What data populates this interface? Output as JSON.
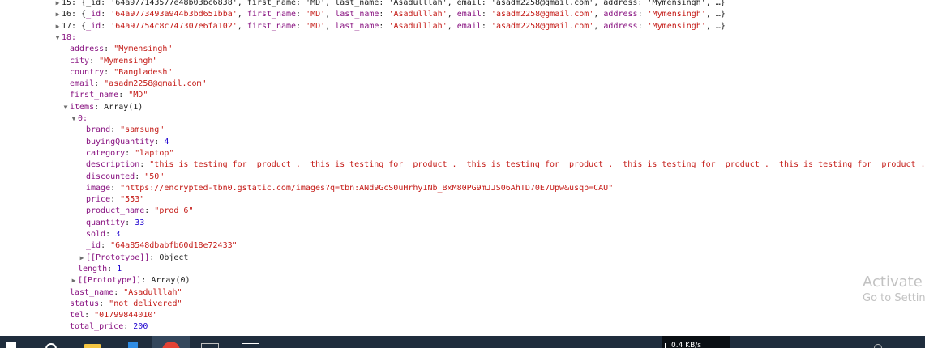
{
  "console": {
    "lines": [
      {
        "indent": 0,
        "toggle": "collapsed",
        "parts": [
          {
            "t": "15: {_id: '64a977143577e48b03bc6838', first_name: 'MD', last_name: 'Asadulllah', email: 'asadm2258@gmail.com', address: 'Mymensingh', …}",
            "c": "p"
          }
        ]
      },
      {
        "indent": 0,
        "toggle": "collapsed",
        "parts": [
          {
            "t": "16: ",
            "c": "p"
          },
          {
            "t": "{",
            "c": "p"
          },
          {
            "t": "_id",
            "c": "sk"
          },
          {
            "t": ": ",
            "c": "p"
          },
          {
            "t": "'64a9773493a944b3bd651bba'",
            "c": "ss"
          },
          {
            "t": ", ",
            "c": "p"
          },
          {
            "t": "first_name",
            "c": "sk"
          },
          {
            "t": ": ",
            "c": "p"
          },
          {
            "t": "'MD'",
            "c": "ss"
          },
          {
            "t": ", ",
            "c": "p"
          },
          {
            "t": "last_name",
            "c": "sk"
          },
          {
            "t": ": ",
            "c": "p"
          },
          {
            "t": "'Asadulllah'",
            "c": "ss"
          },
          {
            "t": ", ",
            "c": "p"
          },
          {
            "t": "email",
            "c": "sk"
          },
          {
            "t": ": ",
            "c": "p"
          },
          {
            "t": "'asadm2258@gmail.com'",
            "c": "ss"
          },
          {
            "t": ", ",
            "c": "p"
          },
          {
            "t": "address",
            "c": "sk"
          },
          {
            "t": ": ",
            "c": "p"
          },
          {
            "t": "'Mymensingh'",
            "c": "ss"
          },
          {
            "t": ", …}",
            "c": "p"
          }
        ]
      },
      {
        "indent": 0,
        "toggle": "collapsed",
        "parts": [
          {
            "t": "17: ",
            "c": "p"
          },
          {
            "t": "{",
            "c": "p"
          },
          {
            "t": "_id",
            "c": "sk"
          },
          {
            "t": ": ",
            "c": "p"
          },
          {
            "t": "'64a97754c8c747307e6fa102'",
            "c": "ss"
          },
          {
            "t": ", ",
            "c": "p"
          },
          {
            "t": "first_name",
            "c": "sk"
          },
          {
            "t": ": ",
            "c": "p"
          },
          {
            "t": "'MD'",
            "c": "ss"
          },
          {
            "t": ", ",
            "c": "p"
          },
          {
            "t": "last_name",
            "c": "sk"
          },
          {
            "t": ": ",
            "c": "p"
          },
          {
            "t": "'Asadulllah'",
            "c": "ss"
          },
          {
            "t": ", ",
            "c": "p"
          },
          {
            "t": "email",
            "c": "sk"
          },
          {
            "t": ": ",
            "c": "p"
          },
          {
            "t": "'asadm2258@gmail.com'",
            "c": "ss"
          },
          {
            "t": ", ",
            "c": "p"
          },
          {
            "t": "address",
            "c": "sk"
          },
          {
            "t": ": ",
            "c": "p"
          },
          {
            "t": "'Mymensingh'",
            "c": "ss"
          },
          {
            "t": ", …}",
            "c": "p"
          }
        ]
      },
      {
        "indent": 0,
        "toggle": "expanded",
        "parts": [
          {
            "t": "18:",
            "c": "k"
          }
        ]
      },
      {
        "indent": 1,
        "toggle": "none",
        "parts": [
          {
            "t": "address",
            "c": "k"
          },
          {
            "t": ": ",
            "c": "p"
          },
          {
            "t": "\"Mymensingh\"",
            "c": "s"
          }
        ]
      },
      {
        "indent": 1,
        "toggle": "none",
        "parts": [
          {
            "t": "city",
            "c": "k"
          },
          {
            "t": ": ",
            "c": "p"
          },
          {
            "t": "\"Mymensingh\"",
            "c": "s"
          }
        ]
      },
      {
        "indent": 1,
        "toggle": "none",
        "parts": [
          {
            "t": "country",
            "c": "k"
          },
          {
            "t": ": ",
            "c": "p"
          },
          {
            "t": "\"Bangladesh\"",
            "c": "s"
          }
        ]
      },
      {
        "indent": 1,
        "toggle": "none",
        "parts": [
          {
            "t": "email",
            "c": "k"
          },
          {
            "t": ": ",
            "c": "p"
          },
          {
            "t": "\"asadm2258@gmail.com\"",
            "c": "s"
          }
        ]
      },
      {
        "indent": 1,
        "toggle": "none",
        "parts": [
          {
            "t": "first_name",
            "c": "k"
          },
          {
            "t": ": ",
            "c": "p"
          },
          {
            "t": "\"MD\"",
            "c": "s"
          }
        ]
      },
      {
        "indent": 1,
        "toggle": "expanded",
        "parts": [
          {
            "t": "items",
            "c": "k"
          },
          {
            "t": ": Array(1)",
            "c": "p"
          }
        ]
      },
      {
        "indent": 2,
        "toggle": "expanded",
        "parts": [
          {
            "t": "0:",
            "c": "k"
          }
        ]
      },
      {
        "indent": 3,
        "toggle": "none",
        "parts": [
          {
            "t": "brand",
            "c": "k"
          },
          {
            "t": ": ",
            "c": "p"
          },
          {
            "t": "\"samsung\"",
            "c": "s"
          }
        ]
      },
      {
        "indent": 3,
        "toggle": "none",
        "parts": [
          {
            "t": "buyingQuantity",
            "c": "k"
          },
          {
            "t": ": ",
            "c": "p"
          },
          {
            "t": "4",
            "c": "n"
          }
        ]
      },
      {
        "indent": 3,
        "toggle": "none",
        "parts": [
          {
            "t": "category",
            "c": "k"
          },
          {
            "t": ": ",
            "c": "p"
          },
          {
            "t": "\"laptop\"",
            "c": "s"
          }
        ]
      },
      {
        "indent": 3,
        "toggle": "none",
        "parts": [
          {
            "t": "description",
            "c": "k"
          },
          {
            "t": ": ",
            "c": "p"
          },
          {
            "t": "\"this is testing for  product .  this is testing for  product .  this is testing for  product .  this is testing for  product .  this is testing for  product . \"",
            "c": "s"
          }
        ]
      },
      {
        "indent": 3,
        "toggle": "none",
        "parts": [
          {
            "t": "discounted",
            "c": "k"
          },
          {
            "t": ": ",
            "c": "p"
          },
          {
            "t": "\"50\"",
            "c": "s"
          }
        ]
      },
      {
        "indent": 3,
        "toggle": "none",
        "parts": [
          {
            "t": "image",
            "c": "k"
          },
          {
            "t": ": ",
            "c": "p"
          },
          {
            "t": "\"https://encrypted-tbn0.gstatic.com/images?q=tbn:ANd9GcS0uHrhy1Nb_BxM80PG9mJJS06AhTD70E7Upw&usqp=CAU\"",
            "c": "s"
          }
        ]
      },
      {
        "indent": 3,
        "toggle": "none",
        "parts": [
          {
            "t": "price",
            "c": "k"
          },
          {
            "t": ": ",
            "c": "p"
          },
          {
            "t": "\"553\"",
            "c": "s"
          }
        ]
      },
      {
        "indent": 3,
        "toggle": "none",
        "parts": [
          {
            "t": "product_name",
            "c": "k"
          },
          {
            "t": ": ",
            "c": "p"
          },
          {
            "t": "\"prod 6\"",
            "c": "s"
          }
        ]
      },
      {
        "indent": 3,
        "toggle": "none",
        "parts": [
          {
            "t": "quantity",
            "c": "k"
          },
          {
            "t": ": ",
            "c": "p"
          },
          {
            "t": "33",
            "c": "n"
          }
        ]
      },
      {
        "indent": 3,
        "toggle": "none",
        "parts": [
          {
            "t": "sold",
            "c": "k"
          },
          {
            "t": ": ",
            "c": "p"
          },
          {
            "t": "3",
            "c": "n"
          }
        ]
      },
      {
        "indent": 3,
        "toggle": "none",
        "parts": [
          {
            "t": "_id",
            "c": "k"
          },
          {
            "t": ": ",
            "c": "p"
          },
          {
            "t": "\"64a8548dbabfb60d18e72433\"",
            "c": "s"
          }
        ]
      },
      {
        "indent": 3,
        "toggle": "collapsed",
        "parts": [
          {
            "t": "[[Prototype]]",
            "c": "k"
          },
          {
            "t": ": Object",
            "c": "p"
          }
        ]
      },
      {
        "indent": 2,
        "toggle": "none",
        "parts": [
          {
            "t": "length",
            "c": "k"
          },
          {
            "t": ": ",
            "c": "p"
          },
          {
            "t": "1",
            "c": "n"
          }
        ]
      },
      {
        "indent": 2,
        "toggle": "collapsed",
        "parts": [
          {
            "t": "[[Prototype]]",
            "c": "k"
          },
          {
            "t": ": Array(0)",
            "c": "p"
          }
        ]
      },
      {
        "indent": 1,
        "toggle": "none",
        "parts": [
          {
            "t": "last_name",
            "c": "k"
          },
          {
            "t": ": ",
            "c": "p"
          },
          {
            "t": "\"Asadulllah\"",
            "c": "s"
          }
        ]
      },
      {
        "indent": 1,
        "toggle": "none",
        "parts": [
          {
            "t": "status",
            "c": "k"
          },
          {
            "t": ": ",
            "c": "p"
          },
          {
            "t": "\"not delivered\"",
            "c": "s"
          }
        ]
      },
      {
        "indent": 1,
        "toggle": "none",
        "parts": [
          {
            "t": "tel",
            "c": "k"
          },
          {
            "t": ": ",
            "c": "p"
          },
          {
            "t": "\"01799844010\"",
            "c": "s"
          }
        ]
      },
      {
        "indent": 1,
        "toggle": "none",
        "parts": [
          {
            "t": "total_price",
            "c": "k"
          },
          {
            "t": ": ",
            "c": "p"
          },
          {
            "t": "200",
            "c": "n"
          }
        ]
      }
    ]
  },
  "watermark": {
    "title": "Activate Windows",
    "subtitle": "Go to Settings to activate Windows."
  },
  "taskbar": {
    "net_speed": "0.4 KB/s",
    "icons": [
      "windows-start-icon",
      "search-icon",
      "file-explorer-icon",
      "vscode-icon",
      "chrome-icon",
      "terminal-icon",
      "window-icon",
      "network-speed-widget",
      "tray-icon"
    ]
  },
  "colors": {
    "key": "#881280",
    "string": "#c41a16",
    "number": "#1c00cf",
    "plain": "#222222",
    "toggle": "#6e6e6e",
    "taskbar": "#1f2d3d",
    "watermark": "#c2c2c2"
  }
}
